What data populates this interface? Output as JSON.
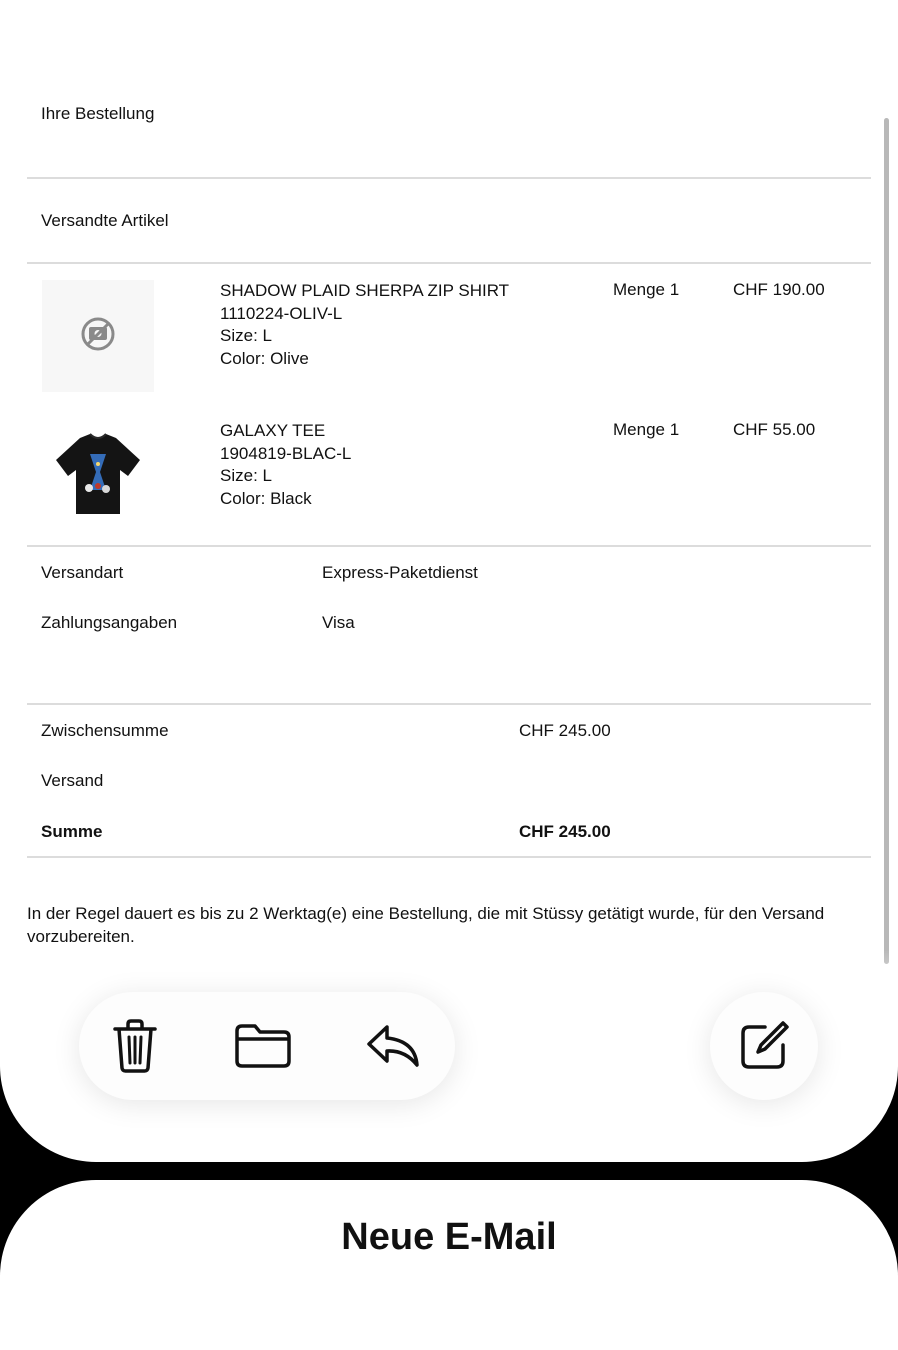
{
  "order": {
    "heading": "Ihre Bestellung",
    "shipped_heading": "Versandte Artikel",
    "items": [
      {
        "name": "SHADOW PLAID SHERPA ZIP SHIRT",
        "sku": "1110224-OLIV-L",
        "size": "Size: L",
        "color": "Color: Olive",
        "quantity": "Menge 1",
        "price": "CHF 190.00",
        "image_icon": "no-photo-icon"
      },
      {
        "name": "GALAXY TEE",
        "sku": "1904819-BLAC-L",
        "size": "Size: L",
        "color": "Color: Black",
        "quantity": "Menge 1",
        "price": "CHF 55.00",
        "image_icon": "tshirt-image"
      }
    ],
    "shipping_method_label": "Versandart",
    "shipping_method_value": "Express-Paketdienst",
    "payment_label": "Zahlungsangaben",
    "payment_value": "Visa",
    "subtotal_label": "Zwischensumme",
    "subtotal_value": "CHF 245.00",
    "shipping_label": "Versand",
    "total_label": "Summe",
    "total_value": "CHF 245.00",
    "note": "In der Regel dauert es bis zu 2 Werktag(e) eine Bestellung, die mit Stüssy getätigt wurde, für den Versand vorzubereiten."
  },
  "toolbar": {
    "icons": [
      "trash-icon",
      "folder-icon",
      "reply-icon",
      "compose-icon"
    ]
  },
  "new_mail": {
    "title": "Neue E-Mail"
  },
  "colors": {
    "background": "#000000",
    "sheet": "#ffffff",
    "divider": "#dcdcdc",
    "text": "#111111"
  }
}
